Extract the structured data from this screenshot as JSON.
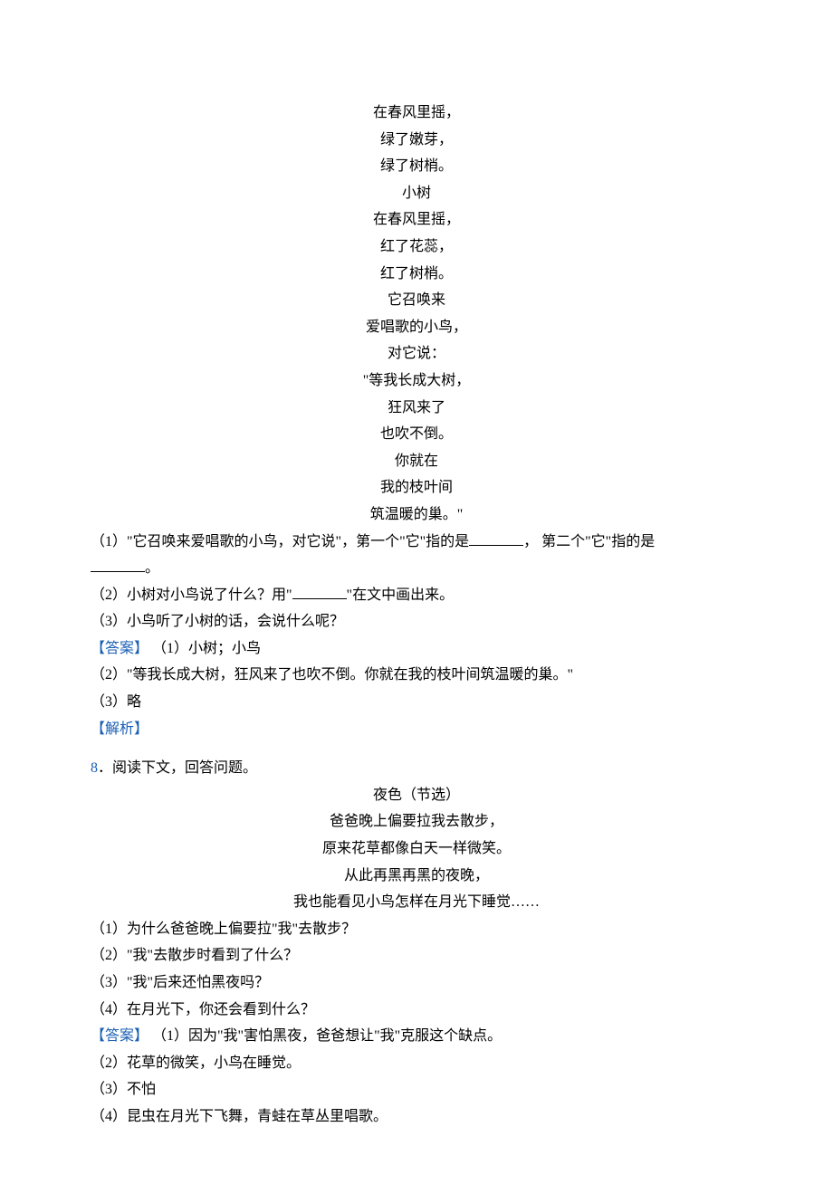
{
  "poem1": {
    "l1": "在春风里摇，",
    "l2": "绿了嫩芽，",
    "l3": "绿了树梢。",
    "l4": "小树",
    "l5": "在春风里摇，",
    "l6": "红了花蕊，",
    "l7": "红了树梢。",
    "l8": "它召唤来",
    "l9": "爱唱歌的小鸟，",
    "l10": "对它说：",
    "l11": "\"等我长成大树，",
    "l12": "狂风来了",
    "l13": "也吹不倒。",
    "l14": "你就在",
    "l15": "我的枝叶间",
    "l16": "筑温暖的巢。\""
  },
  "q1": {
    "part1a": "（1）\"它召唤来爱唱歌的小鸟，对它说\"，第一个\"它\"指的是",
    "part1b": "， 第二个\"它\"指的是",
    "part1c": "。",
    "part2a": "（2）小树对小鸟说了什么？用\"",
    "part2b": "\"在文中画出来。",
    "part3": "（3）小鸟听了小树的话，会说什么呢？",
    "ans_label": "【答案】",
    "ans1": " （1）小树；小鸟",
    "ans2": "（2）\"等我长成大树，狂风来了也吹不倒。你就在我的枝叶间筑温暖的巢。\"",
    "ans3": "（3）略",
    "analysis_label": "【解析】"
  },
  "q2": {
    "num": "8",
    "stem": "．阅读下文，回答问题。",
    "title": "夜色（节选）",
    "l1": "爸爸晚上偏要拉我去散步，",
    "l2": "原来花草都像白天一样微笑。",
    "l3": "从此再黑再黑的夜晚，",
    "l4": "我也能看见小鸟怎样在月光下睡觉……",
    "p1": "（1）为什么爸爸晚上偏要拉\"我\"去散步？",
    "p2": "（2）\"我\"去散步时看到了什么？",
    "p3": "（3）\"我\"后来还怕黑夜吗？",
    "p4": "（4）在月光下，你还会看到什么？",
    "ans_label": "【答案】",
    "ans1": " （1）因为\"我\"害怕黑夜，爸爸想让\"我\"克服这个缺点。",
    "ans2": "（2）花草的微笑，小鸟在睡觉。",
    "ans3": "（3）不怕",
    "ans4": "（4）昆虫在月光下飞舞，青蛙在草丛里唱歌。"
  }
}
